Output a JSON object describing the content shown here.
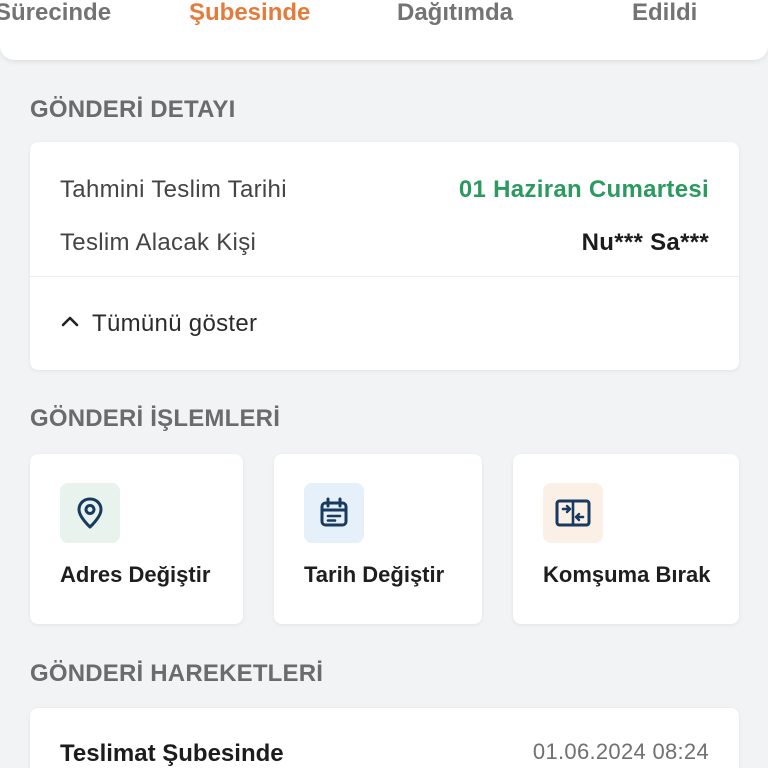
{
  "tabs": [
    {
      "label": "Sürecinde",
      "active": false
    },
    {
      "label": "Şubesinde",
      "active": true
    },
    {
      "label": "Dağıtımda",
      "active": false
    },
    {
      "label": "Edildi",
      "active": false
    }
  ],
  "detail": {
    "section_title": "GÖNDERİ DETAYI",
    "estimated_label": "Tahmini Teslim Tarihi",
    "estimated_value": "01 Haziran Cumartesi",
    "recipient_label": "Teslim Alacak Kişi",
    "recipient_value": "Nu*** Sa***",
    "show_all": "Tümünü göster"
  },
  "operations": {
    "section_title": "GÖNDERİ İŞLEMLERİ",
    "items": [
      {
        "label": "Adres Değiştir",
        "icon": "location-pin-icon"
      },
      {
        "label": "Tarih Değiştir",
        "icon": "calendar-icon"
      },
      {
        "label": "Komşuma Bırak",
        "icon": "transfer-icon"
      }
    ]
  },
  "movements": {
    "section_title": "GÖNDERİ HAREKETLERİ",
    "items": [
      {
        "title": "Teslimat Şubesinde",
        "date": "01.06.2024 08:24"
      }
    ]
  },
  "colors": {
    "accent": "#e57b3a",
    "success": "#2a9a5f",
    "icon_stroke": "#173a5e"
  }
}
